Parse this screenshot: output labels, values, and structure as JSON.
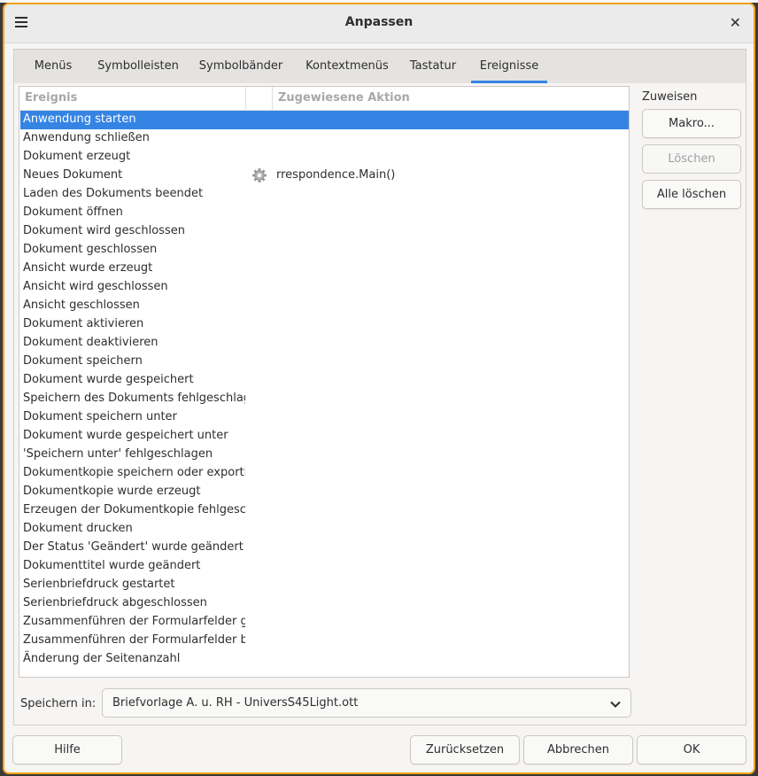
{
  "window": {
    "title": "Anpassen"
  },
  "tabs": [
    {
      "label": "Menüs"
    },
    {
      "label": "Symbolleisten"
    },
    {
      "label": "Symbolbänder"
    },
    {
      "label": "Kontextmenüs"
    },
    {
      "label": "Tastatur"
    },
    {
      "label": "Ereignisse"
    }
  ],
  "active_tab": "Ereignisse",
  "table": {
    "headers": {
      "event": "Ereignis",
      "action": "Zugewiesene Aktion"
    },
    "rows": [
      {
        "event": "Anwendung starten",
        "action": "",
        "selected": true
      },
      {
        "event": "Anwendung schließen",
        "action": ""
      },
      {
        "event": "Dokument erzeugt",
        "action": ""
      },
      {
        "event": "Neues Dokument",
        "action": "rrespondence.Main()",
        "icon": "gear-icon"
      },
      {
        "event": "Laden des Dokuments beendet",
        "action": ""
      },
      {
        "event": "Dokument öffnen",
        "action": ""
      },
      {
        "event": "Dokument wird geschlossen",
        "action": ""
      },
      {
        "event": "Dokument geschlossen",
        "action": ""
      },
      {
        "event": "Ansicht wurde erzeugt",
        "action": ""
      },
      {
        "event": "Ansicht wird geschlossen",
        "action": ""
      },
      {
        "event": "Ansicht geschlossen",
        "action": ""
      },
      {
        "event": "Dokument aktivieren",
        "action": ""
      },
      {
        "event": "Dokument deaktivieren",
        "action": ""
      },
      {
        "event": "Dokument speichern",
        "action": ""
      },
      {
        "event": "Dokument wurde gespeichert",
        "action": ""
      },
      {
        "event": "Speichern des Dokuments fehlgeschlagen",
        "action": ""
      },
      {
        "event": "Dokument speichern unter",
        "action": ""
      },
      {
        "event": "Dokument wurde gespeichert unter",
        "action": ""
      },
      {
        "event": "'Speichern unter' fehlgeschlagen",
        "action": ""
      },
      {
        "event": "Dokumentkopie speichern oder exportieren",
        "action": ""
      },
      {
        "event": "Dokumentkopie wurde erzeugt",
        "action": ""
      },
      {
        "event": "Erzeugen der Dokumentkopie fehlgeschlagen",
        "action": ""
      },
      {
        "event": "Dokument drucken",
        "action": ""
      },
      {
        "event": "Der Status 'Geändert' wurde geändert",
        "action": ""
      },
      {
        "event": "Dokumenttitel wurde geändert",
        "action": ""
      },
      {
        "event": "Serienbriefdruck gestartet",
        "action": ""
      },
      {
        "event": "Serienbriefdruck abgeschlossen",
        "action": ""
      },
      {
        "event": "Zusammenführen der Formularfelder gestartet",
        "action": ""
      },
      {
        "event": "Zusammenführen der Formularfelder beendet",
        "action": ""
      },
      {
        "event": "Änderung der Seitenanzahl",
        "action": ""
      }
    ]
  },
  "assign": {
    "label": "Zuweisen",
    "macro_button": "Makro...",
    "delete_button": "Löschen",
    "delete_all_button": "Alle löschen"
  },
  "save_in": {
    "label": "Speichern in:",
    "value": "Briefvorlage A. u. RH - UniversS45Light.ott"
  },
  "footer": {
    "help": "Hilfe",
    "reset": "Zurücksetzen",
    "cancel": "Abbrechen",
    "ok": "OK"
  }
}
